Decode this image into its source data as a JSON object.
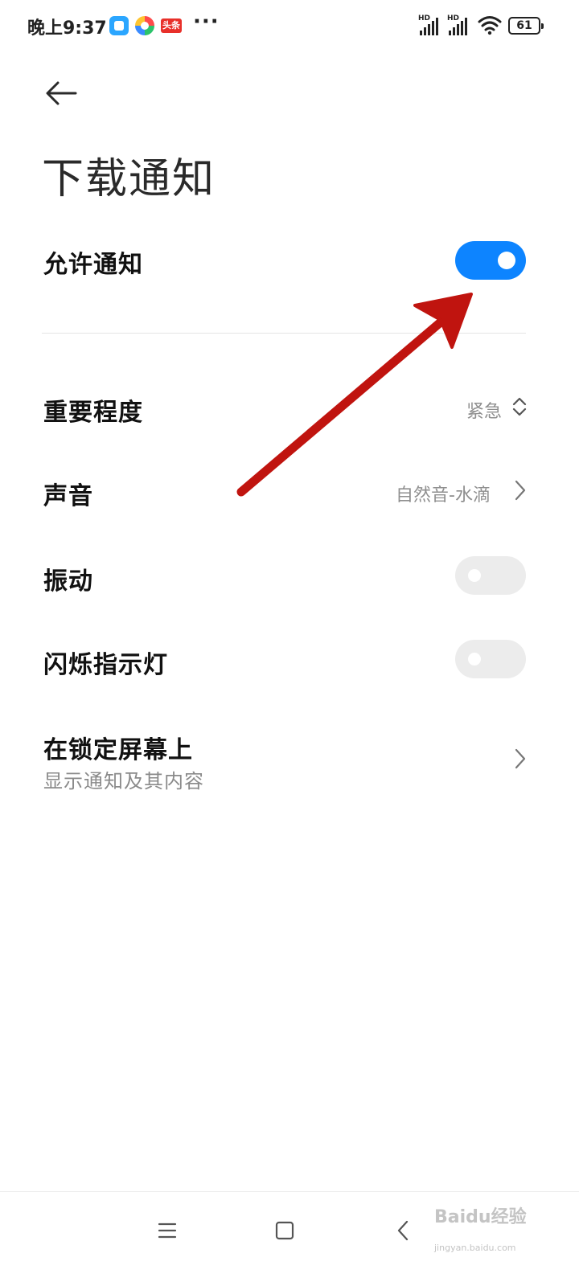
{
  "status_bar": {
    "time": "晚上9:37",
    "more": "···",
    "signal_label": "HD",
    "battery": "61"
  },
  "header": {
    "title": "下载通知"
  },
  "settings": {
    "allow_notifications": {
      "label": "允许通知",
      "enabled": true
    },
    "importance": {
      "label": "重要程度",
      "value": "紧急"
    },
    "sound": {
      "label": "声音",
      "value": "自然音-水滴"
    },
    "vibration": {
      "label": "振动",
      "enabled": false
    },
    "indicator_light": {
      "label": "闪烁指示灯",
      "enabled": false
    },
    "lock_screen": {
      "label": "在锁定屏幕上",
      "sub": "显示通知及其内容"
    }
  },
  "colors": {
    "accent": "#0d84ff",
    "toggle_off": "#ececec",
    "annotation": "#c0140f"
  },
  "icons": {
    "back": "back-arrow-icon",
    "chevron": "chevron-right-icon",
    "updown": "up-down-chevron-icon",
    "nav_menu": "menu-icon",
    "nav_home": "home-square-icon",
    "nav_back": "nav-back-icon"
  },
  "watermark": {
    "logo": "Baidu经验",
    "url": "jingyan.baidu.com"
  }
}
